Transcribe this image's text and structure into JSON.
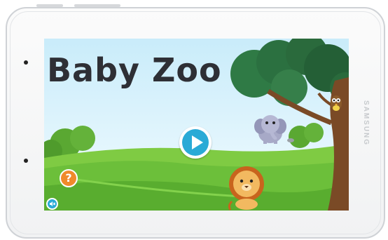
{
  "device": {
    "brand": "SAMSUNG"
  },
  "game": {
    "title": "Baby Zoo"
  },
  "controls": {
    "play_icon": "play-icon",
    "help_glyph": "?",
    "sound_icon": "sound-icon"
  },
  "colors": {
    "sky": "#dff2fb",
    "grass": "#6cbf3a",
    "accent_blue": "#2aaad6",
    "help_orange": "#f08a2b",
    "title_dark": "#2e2f35"
  }
}
